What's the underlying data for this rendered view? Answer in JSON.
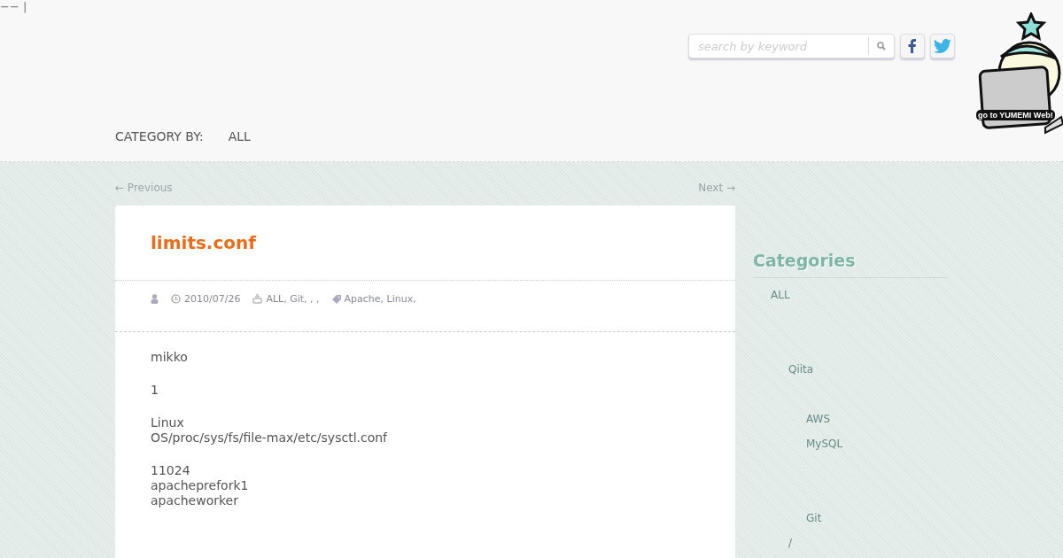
{
  "top_mark": "−− |",
  "search": {
    "placeholder": "search by keyword"
  },
  "banner": {
    "caption": "go to YUMEMI Web!"
  },
  "category_bar": {
    "label": "CATEGORY BY:",
    "items": [
      "ALL"
    ]
  },
  "pager": {
    "previous": "← Previous",
    "next": "Next →"
  },
  "post": {
    "title": "limits.conf",
    "date": "2010/07/26",
    "categories": "ALL, Git, , ,",
    "tags": "Apache, Linux,",
    "paragraphs": [
      [
        "mikko"
      ],
      [
        "1"
      ],
      [
        "Linux",
        "OS/proc/sys/fs/file-max/etc/sysctl.conf"
      ],
      [
        "11024",
        "apacheprefork1",
        "apacheworker"
      ]
    ]
  },
  "sidebar": {
    "title": "Categories",
    "items": [
      {
        "label": "ALL",
        "children": [
          {
            "label": "Qiita",
            "children": [
              {
                "label": "AWS"
              },
              {
                "label": "MySQL"
              },
              {
                "label": "Git"
              }
            ]
          },
          {
            "label": "/"
          }
        ]
      }
    ]
  }
}
